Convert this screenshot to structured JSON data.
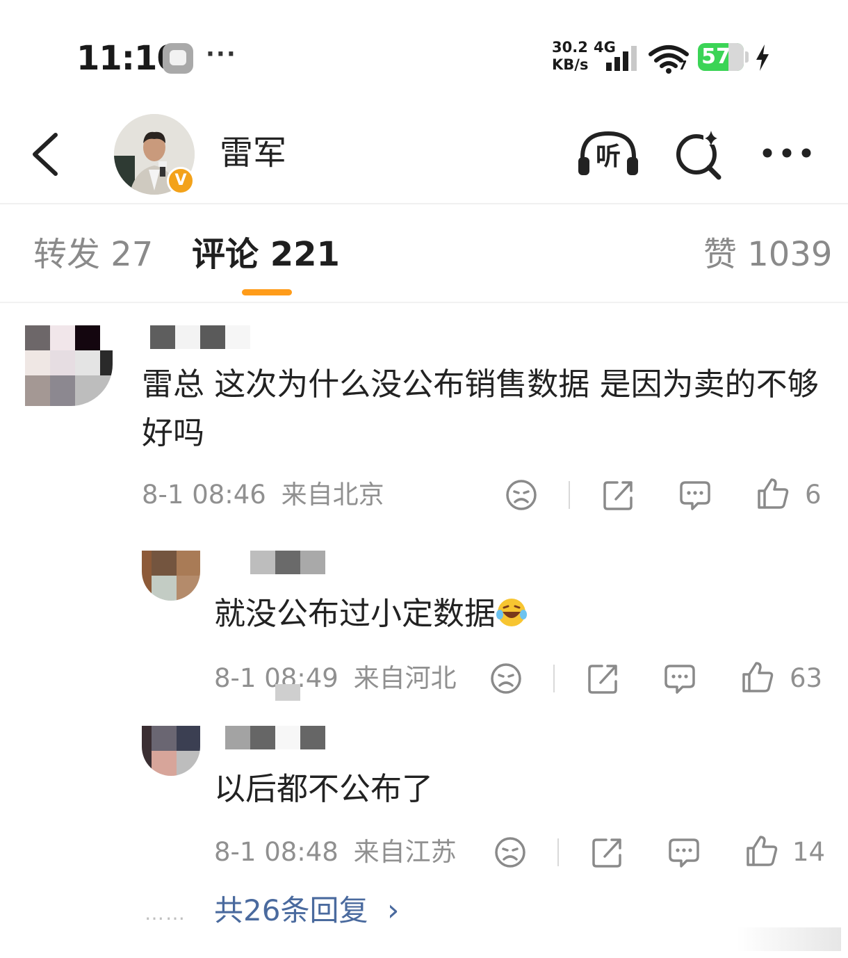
{
  "status_bar": {
    "time": "11:10",
    "dots": "···",
    "net_speed": "30.2\nKB/s",
    "net_type": "4G",
    "wifi_sub": "7",
    "battery": "57",
    "battery_level_percent": 57
  },
  "header": {
    "back_icon": "chevron-left-icon",
    "name": "雷军",
    "verified_badge": "V",
    "listen_label": "听",
    "search_icon": "search-sparkle-icon",
    "more_icon": "more-horizontal-icon"
  },
  "tabs": {
    "repost": "转发 27",
    "comments": "评论 221",
    "likes": "赞 1039",
    "active": "comments",
    "accent_color": "#ff9c1a"
  },
  "comments": [
    {
      "text": "雷总 这次为什么没公布销售数据 是因为卖的不够好吗",
      "time": "8-1 08:46",
      "location": "来自北京",
      "likes": "6"
    }
  ],
  "replies": [
    {
      "text": "就没公布过小定数据",
      "emoji": "laughing-crying-emoji",
      "time": "8-1 08:49",
      "location": "来自河北",
      "likes": "63"
    },
    {
      "text": "以后都不公布了",
      "time": "8-1 08:48",
      "location": "来自江苏",
      "likes": "14"
    }
  ],
  "more_replies": {
    "dots": "……",
    "label": "共26条回复",
    "arrow": "›",
    "link_color": "#4a6a9e"
  }
}
